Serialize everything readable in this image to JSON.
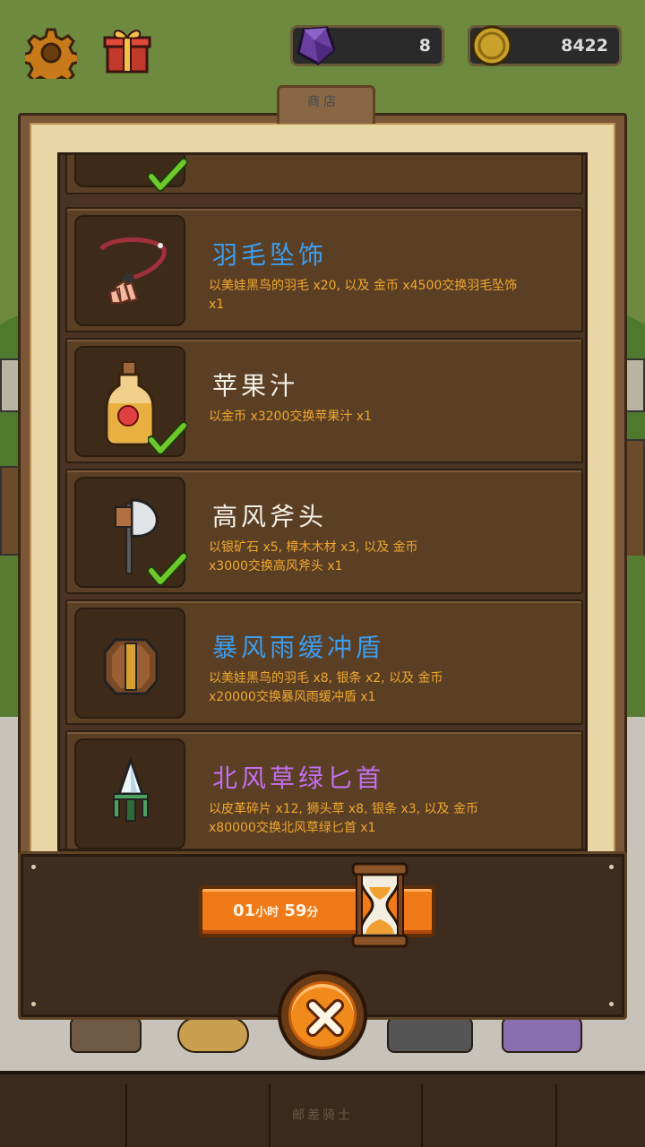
{
  "hud": {
    "gem_count": "8",
    "coin_count": "8422",
    "settings_icon": "gear-icon",
    "gift_icon": "gift-icon"
  },
  "shop": {
    "tab_label": "商店",
    "items": [
      {
        "name": "羽毛坠饰",
        "name_color": "#3b9df0",
        "desc_line1": "以美娃黑鸟的羽毛 x20, 以及 金币 x4500交换羽毛坠饰",
        "desc_line2": "x1",
        "icon": "necklace-icon",
        "owned": false
      },
      {
        "name": "苹果汁",
        "name_color": "#f4f0e6",
        "desc_line1": "以金币 x3200交换苹果汁 x1",
        "desc_line2": "",
        "icon": "apple-juice-bottle-icon",
        "owned": true
      },
      {
        "name": "高风斧头",
        "name_color": "#f4f0e6",
        "desc_line1": "以银矿石 x5, 樟木木材 x3, 以及 金币",
        "desc_line2": "x3000交换高风斧头 x1",
        "icon": "axe-icon",
        "owned": true
      },
      {
        "name": "暴风雨缓冲盾",
        "name_color": "#3b9df0",
        "desc_line1": "以美娃黑鸟的羽毛 x8, 银条 x2, 以及 金币",
        "desc_line2": "x20000交换暴风雨缓冲盾 x1",
        "icon": "shield-icon",
        "owned": false
      },
      {
        "name": "北风草绿匕首",
        "name_color": "#c46ff0",
        "desc_line1": "以皮革碎片 x12, 狮头草 x8, 银条 x3, 以及 金币",
        "desc_line2": "x80000交换北风草绿匕首 x1",
        "icon": "dagger-icon",
        "owned": false
      }
    ]
  },
  "timer": {
    "hours": "01",
    "hours_unit": "小时",
    "minutes": "59",
    "minutes_unit": "分"
  },
  "footer": {
    "label": "邮差骑士"
  }
}
